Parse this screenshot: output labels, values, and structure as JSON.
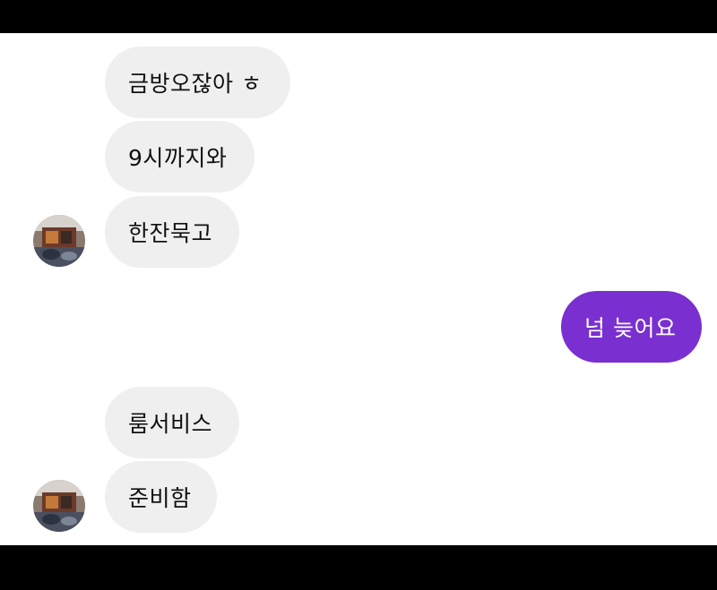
{
  "conversation": {
    "group1": {
      "messages": [
        "금방오잖아 ㅎ",
        "9시까지와",
        "한잔묵고"
      ],
      "sender_avatar": "room-photo-avatar"
    },
    "sent": {
      "message": "넘 늦어요",
      "color": "#7a2fd0"
    },
    "group2": {
      "messages": [
        "룸서비스",
        "준비함"
      ],
      "sender_avatar": "room-photo-avatar"
    },
    "incoming_bubble_color": "#efefef"
  }
}
